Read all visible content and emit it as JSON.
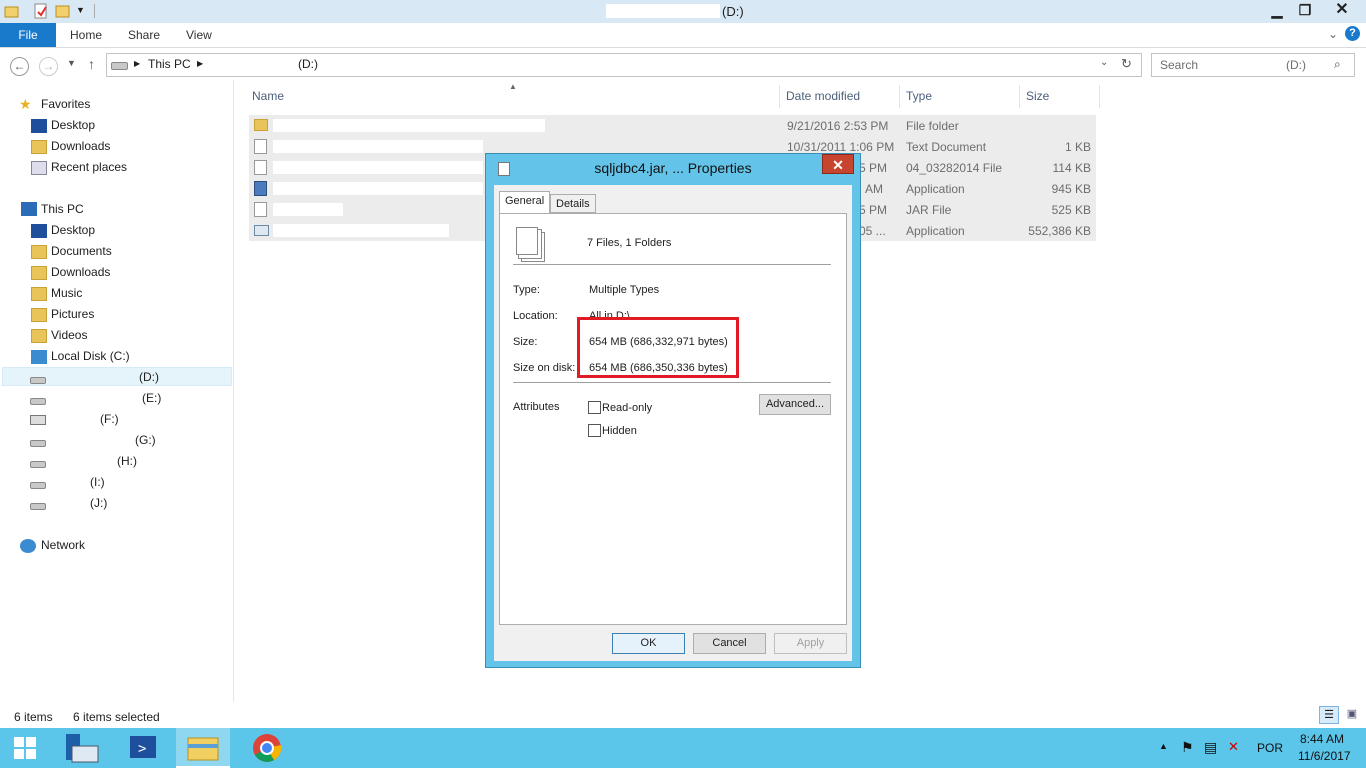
{
  "window": {
    "title": "(D:)",
    "controls": [
      "minimize",
      "maximize",
      "close"
    ]
  },
  "ribbon": {
    "file_tab": "File",
    "tabs": [
      "Home",
      "Share",
      "View"
    ]
  },
  "address": {
    "crumbs": [
      "This PC",
      "(D:)"
    ],
    "search_placeholder": "Search",
    "search_scope": "(D:)"
  },
  "nav": {
    "favorites": "Favorites",
    "favorites_items": [
      "Desktop",
      "Downloads",
      "Recent places"
    ],
    "this_pc": "This PC",
    "this_pc_items": [
      "Desktop",
      "Documents",
      "Downloads",
      "Music",
      "Pictures",
      "Videos",
      "Local Disk (C:)"
    ],
    "drives": [
      "(D:)",
      "(E:)",
      "(F:)",
      "(G:)",
      "(H:)",
      "(I:)",
      "(J:)"
    ],
    "network": "Network"
  },
  "list": {
    "columns": [
      "Name",
      "Date modified",
      "Type",
      "Size"
    ],
    "rows": [
      {
        "date": "9/21/2016 2:53 PM",
        "type": "File folder",
        "size": ""
      },
      {
        "date": "10/31/2011 1:06 PM",
        "type": "Text Document",
        "size": "1 KB"
      },
      {
        "date": "5 PM",
        "type": "04_03282014 File",
        "size": "114 KB"
      },
      {
        "date": "AM",
        "type": "Application",
        "size": "945 KB"
      },
      {
        "date": "5 PM",
        "type": "JAR File",
        "size": "525 KB"
      },
      {
        "date": "05 ...",
        "type": "Application",
        "size": "552,386 KB"
      }
    ]
  },
  "status": {
    "items": "6 items",
    "selected": "6 items selected"
  },
  "dialog": {
    "title": "sqljdbc4.jar, ... Properties",
    "tabs": [
      "General",
      "Details"
    ],
    "summary": "7 Files, 1 Folders",
    "type_label": "Type:",
    "type_value": "Multiple Types",
    "location_label": "Location:",
    "location_value": "All in D:\\",
    "size_label": "Size:",
    "size_value": "654 MB (686,332,971 bytes)",
    "size_on_disk_label": "Size on disk:",
    "size_on_disk_value": "654 MB (686,350,336 bytes)",
    "attributes_label": "Attributes",
    "readonly_label": "Read-only",
    "hidden_label": "Hidden",
    "advanced_button": "Advanced...",
    "ok_button": "OK",
    "cancel_button": "Cancel",
    "apply_button": "Apply",
    "close_glyph": "✕"
  },
  "taskbar": {
    "time": "8:44 AM",
    "date": "11/6/2017",
    "language": "POR"
  },
  "colors": {
    "accent": "#1979ca",
    "taskbar": "#5bc5ea",
    "dialog_frame": "#64c3e8",
    "highlight_box": "#e01b24"
  }
}
